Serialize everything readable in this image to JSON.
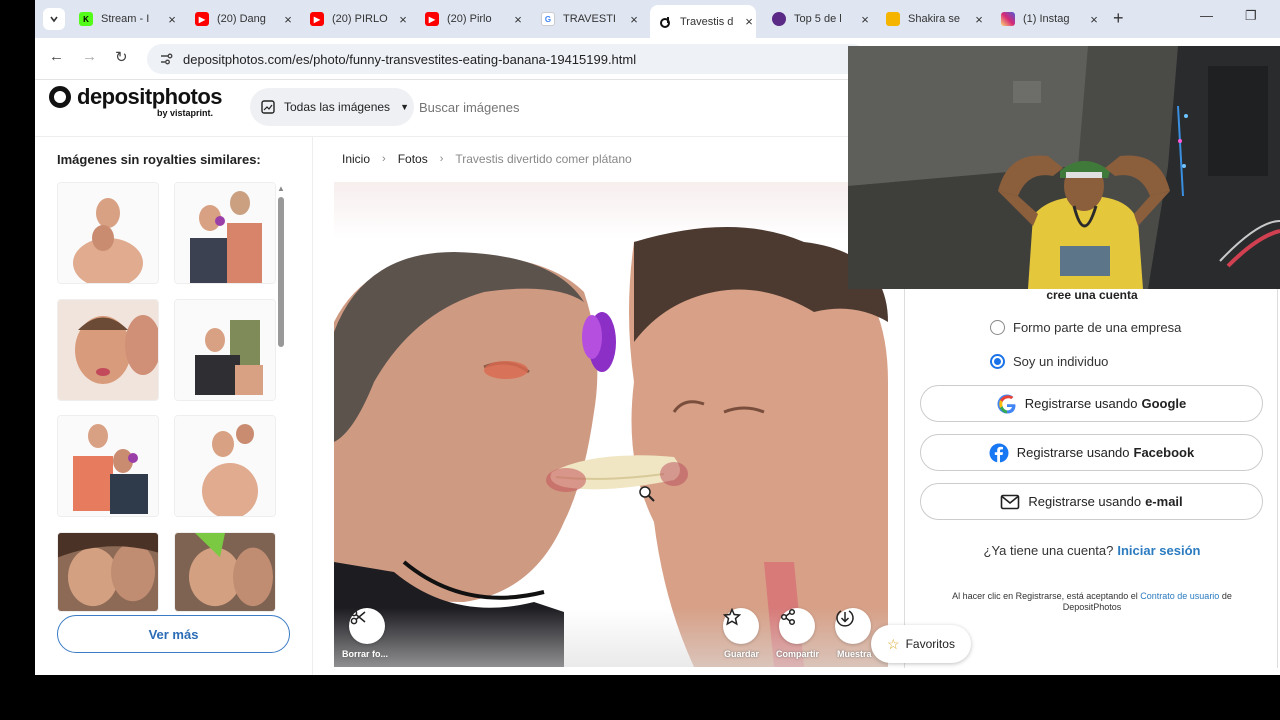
{
  "tabs": [
    {
      "title": "Stream - I",
      "favicon": "kick-icon",
      "color": "#53fc18"
    },
    {
      "title": "(20) Dang",
      "favicon": "youtube-icon",
      "color": "#ff0000"
    },
    {
      "title": "(20) PIRLO",
      "favicon": "youtube-icon",
      "color": "#ff0000"
    },
    {
      "title": "(20) Pirlo",
      "favicon": "youtube-icon",
      "color": "#ff0000"
    },
    {
      "title": "TRAVESTI",
      "favicon": "google-icon",
      "color": "#4285f4"
    },
    {
      "title": "Travestis d",
      "favicon": "depositphotos-icon",
      "color": "#111111"
    },
    {
      "title": "Top 5 de l",
      "favicon": "site-icon",
      "color": "#5b2a86"
    },
    {
      "title": "Shakira se",
      "favicon": "site-icon",
      "color": "#f4b400"
    },
    {
      "title": "(1) Instag",
      "favicon": "instagram-icon",
      "color": "#d62976"
    }
  ],
  "address": {
    "url": "depositphotos.com/es/photo/funny-transvestites-eating-banana-19415199.html"
  },
  "header": {
    "brand": "depositphotos",
    "by": "by vistaprint.",
    "filter_label": "Todas las imágenes",
    "search_placeholder": "Buscar imágenes"
  },
  "sidebar": {
    "title": "Imágenes sin royalties similares:",
    "more_label": "Ver más"
  },
  "breadcrumb": {
    "home": "Inicio",
    "section": "Fotos",
    "current": "Travestis divertido comer plátano"
  },
  "image_actions": {
    "erase": "Borrar fo...",
    "save": "Guardar",
    "share": "Compartir",
    "sample": "Muestra"
  },
  "signup": {
    "heading": "cree una cuenta",
    "option_company": "Formo parte de una empresa",
    "option_individual": "Soy un individuo",
    "google_prefix": "Registrarse usando",
    "google_name": "Google",
    "facebook_prefix": "Registrarse usando",
    "facebook_name": "Facebook",
    "email_prefix": "Registrarse usando",
    "email_name": "e-mail",
    "have_account": "¿Ya tiene una cuenta?",
    "login": "Iniciar sesión",
    "legal_prefix": "Al hacer clic en Registrarse, está aceptando el",
    "legal_link": "Contrato de usuario",
    "legal_suffix": "de DepositPhotos"
  },
  "favorites_label": "Favoritos",
  "colors": {
    "accent_blue": "#2b7bc0",
    "radio_blue": "#1a73e8",
    "tabstrip": "#dfe6f2"
  }
}
